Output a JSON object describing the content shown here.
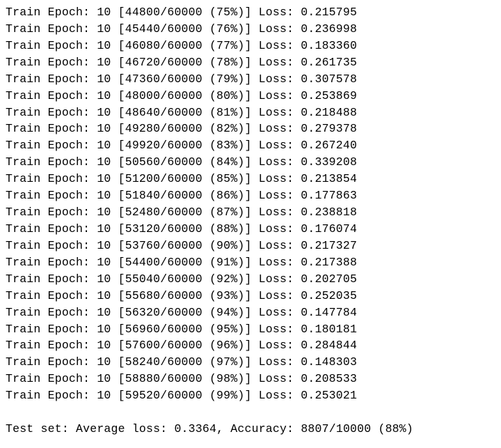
{
  "prefix": "Train Epoch: ",
  "epoch": "10",
  "total": "60000",
  "loss_label": "Loss: ",
  "rows": [
    {
      "proc": "44800",
      "pct": "75",
      "loss": "0.215795"
    },
    {
      "proc": "45440",
      "pct": "76",
      "loss": "0.236998"
    },
    {
      "proc": "46080",
      "pct": "77",
      "loss": "0.183360"
    },
    {
      "proc": "46720",
      "pct": "78",
      "loss": "0.261735"
    },
    {
      "proc": "47360",
      "pct": "79",
      "loss": "0.307578"
    },
    {
      "proc": "48000",
      "pct": "80",
      "loss": "0.253869"
    },
    {
      "proc": "48640",
      "pct": "81",
      "loss": "0.218488"
    },
    {
      "proc": "49280",
      "pct": "82",
      "loss": "0.279378"
    },
    {
      "proc": "49920",
      "pct": "83",
      "loss": "0.267240"
    },
    {
      "proc": "50560",
      "pct": "84",
      "loss": "0.339208"
    },
    {
      "proc": "51200",
      "pct": "85",
      "loss": "0.213854"
    },
    {
      "proc": "51840",
      "pct": "86",
      "loss": "0.177863"
    },
    {
      "proc": "52480",
      "pct": "87",
      "loss": "0.238818"
    },
    {
      "proc": "53120",
      "pct": "88",
      "loss": "0.176074"
    },
    {
      "proc": "53760",
      "pct": "90",
      "loss": "0.217327"
    },
    {
      "proc": "54400",
      "pct": "91",
      "loss": "0.217388"
    },
    {
      "proc": "55040",
      "pct": "92",
      "loss": "0.202705"
    },
    {
      "proc": "55680",
      "pct": "93",
      "loss": "0.252035"
    },
    {
      "proc": "56320",
      "pct": "94",
      "loss": "0.147784"
    },
    {
      "proc": "56960",
      "pct": "95",
      "loss": "0.180181"
    },
    {
      "proc": "57600",
      "pct": "96",
      "loss": "0.284844"
    },
    {
      "proc": "58240",
      "pct": "97",
      "loss": "0.148303"
    },
    {
      "proc": "58880",
      "pct": "98",
      "loss": "0.208533"
    },
    {
      "proc": "59520",
      "pct": "99",
      "loss": "0.253021"
    }
  ],
  "summary": {
    "prefix": "Test set: Average loss: ",
    "avg_loss": "0.3364",
    "acc_label": ", Accuracy: ",
    "correct": "8807",
    "total": "10000",
    "acc_pct": "(88%)"
  }
}
